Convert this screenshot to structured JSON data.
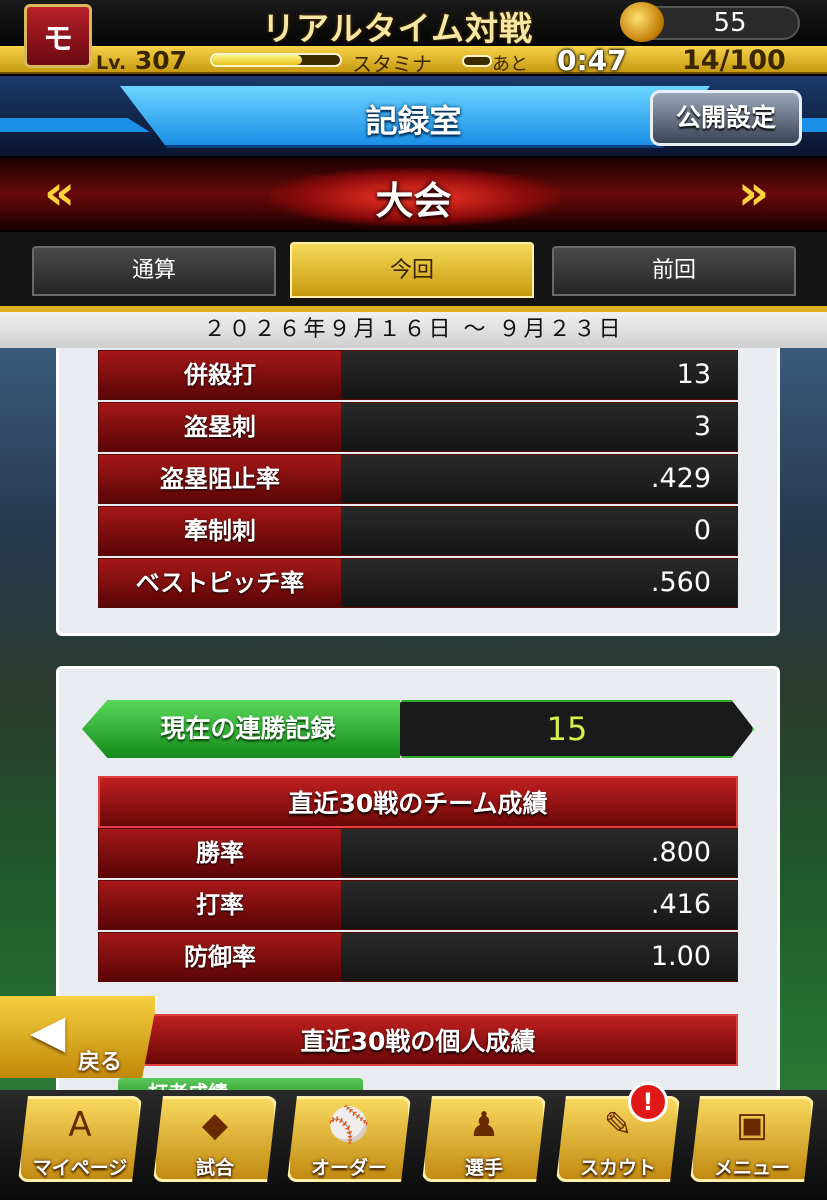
{
  "header": {
    "logo_text": "モ",
    "title": "リアルタイム対戦",
    "coins": "55",
    "level_prefix": "Lv.",
    "level": "307",
    "xp_fraction": 0.7,
    "stamina_label": "スタミナ",
    "stamina_fraction": 0.05,
    "time_label": "あと",
    "time_left": "0:47",
    "stamina_value": "14/100"
  },
  "page": {
    "title": "記録室",
    "public_button": "公開設定"
  },
  "banner": {
    "title": "大会",
    "arrow_left": "«",
    "arrow_right": "»"
  },
  "tabs": [
    {
      "label": "通算",
      "selected": false
    },
    {
      "label": "今回",
      "selected": true
    },
    {
      "label": "前回",
      "selected": false
    }
  ],
  "date_range": "２０２６年９月１６日 〜 ９月２３日",
  "stats_upper": [
    {
      "label": "併殺打",
      "value": "13"
    },
    {
      "label": "盗塁刺",
      "value": "3"
    },
    {
      "label": "盗塁阻止率",
      "value": ".429"
    },
    {
      "label": "牽制刺",
      "value": "0"
    },
    {
      "label": "ベストピッチ率",
      "value": ".560"
    }
  ],
  "streak": {
    "label": "現在の連勝記録",
    "value": "15"
  },
  "team_section": {
    "title": "直近30戦のチーム成績",
    "rows": [
      {
        "label": "勝率",
        "value": ".800"
      },
      {
        "label": "打率",
        "value": ".416"
      },
      {
        "label": "防御率",
        "value": "1.00"
      }
    ]
  },
  "personal_section": {
    "title": "直近30戦の個人成績",
    "sub_tab": "打者成績"
  },
  "back_button": "戻る",
  "nav": [
    {
      "label": "マイページ",
      "icon": "A"
    },
    {
      "label": "試合",
      "icon": "◆"
    },
    {
      "label": "オーダー",
      "icon": "⚾"
    },
    {
      "label": "選手",
      "icon": "♟"
    },
    {
      "label": "スカウト",
      "icon": "✎"
    },
    {
      "label": "メニュー",
      "icon": "▣"
    }
  ],
  "scout_badge": "!",
  "colors": {
    "accent_gold": "#e0b020",
    "header_blue": "#1b8ee6",
    "stat_red": "#a51818",
    "streak_green": "#2aa82a"
  }
}
